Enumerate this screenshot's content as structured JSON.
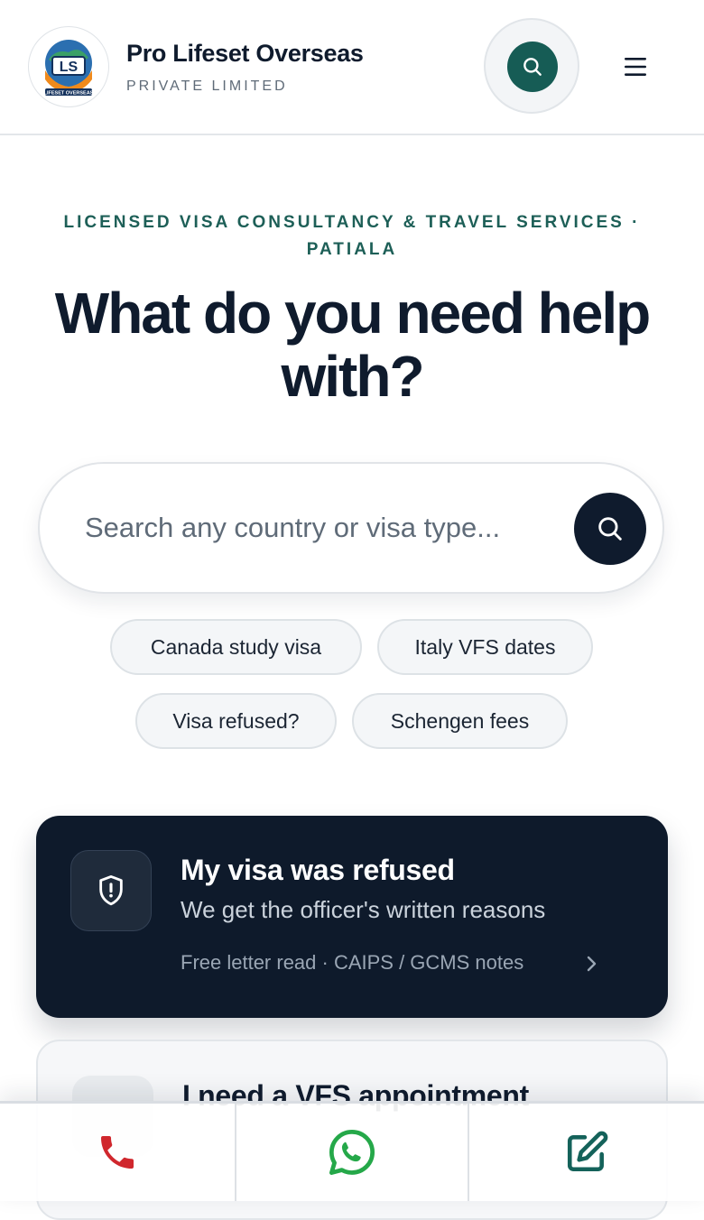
{
  "header": {
    "brand_name": "Pro Lifeset Overseas",
    "brand_subtitle": "PRIVATE LIMITED",
    "logo_initials": "LS",
    "logo_text": "LIFESET OVERSEAS",
    "search_icon": "search-icon",
    "menu_icon": "hamburger-menu-icon"
  },
  "hero": {
    "kicker": "LICENSED VISA CONSULTANCY & TRAVEL SERVICES · PATIALA",
    "headline": "What do you need help with?"
  },
  "search": {
    "placeholder": "Search any country or visa type...",
    "value": "",
    "button_icon": "search-icon"
  },
  "chips": [
    "Canada study visa",
    "Italy VFS dates",
    "Visa refused?",
    "Schengen fees"
  ],
  "cards": [
    {
      "icon": "shield-alert-icon",
      "title": "My visa was refused",
      "description": "We get the officer's written reasons",
      "meta": "Free letter read · CAIPS / GCMS notes"
    },
    {
      "icon": "calendar-icon",
      "title": "I need a VFS appointment"
    }
  ],
  "bottom_bar": {
    "items": [
      "phone-icon",
      "whatsapp-icon",
      "edit-icon"
    ]
  },
  "colors": {
    "brand_green": "#165c55",
    "kicker_green": "#1d5f57",
    "navy": "#0f1b2d",
    "phone_red": "#d0272d",
    "whatsapp_green": "#25a849",
    "edit_teal": "#14625a"
  }
}
